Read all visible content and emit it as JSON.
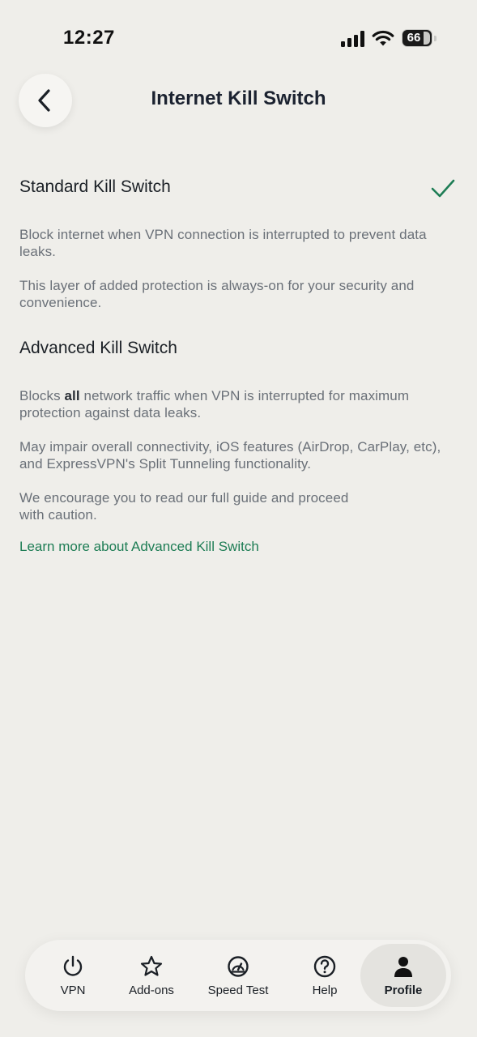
{
  "status_bar": {
    "time": "12:27",
    "battery": "66"
  },
  "header": {
    "title": "Internet Kill Switch",
    "back_icon": "chevron-left-icon"
  },
  "options": {
    "standard": {
      "title": "Standard Kill Switch",
      "selected": true,
      "desc1": "Block internet when VPN connection is interrupted to prevent data leaks.",
      "desc2": "This layer of added protection is always-on for your security and convenience."
    },
    "advanced": {
      "title": "Advanced Kill Switch",
      "desc1_before": "Blocks ",
      "desc1_bold": "all",
      "desc1_after": " network traffic when VPN is interrupted for maximum protection against data leaks.",
      "desc2": "May impair overall connectivity, iOS features (AirDrop, CarPlay, etc), and ExpressVPN's Split Tunneling functionality.",
      "desc3_line1": "We encourage you to read our full guide and proceed",
      "desc3_line2": "with caution.",
      "link": "Learn more about Advanced Kill Switch"
    }
  },
  "nav": {
    "items": [
      {
        "label": "VPN",
        "icon": "power-icon"
      },
      {
        "label": "Add-ons",
        "icon": "star-icon"
      },
      {
        "label": "Speed Test",
        "icon": "speedometer-icon"
      },
      {
        "label": "Help",
        "icon": "question-circle-icon"
      },
      {
        "label": "Profile",
        "icon": "person-icon",
        "active": true
      }
    ]
  },
  "colors": {
    "accent": "#1e7d55",
    "background": "#efeeea",
    "text_secondary": "#6a7078"
  }
}
